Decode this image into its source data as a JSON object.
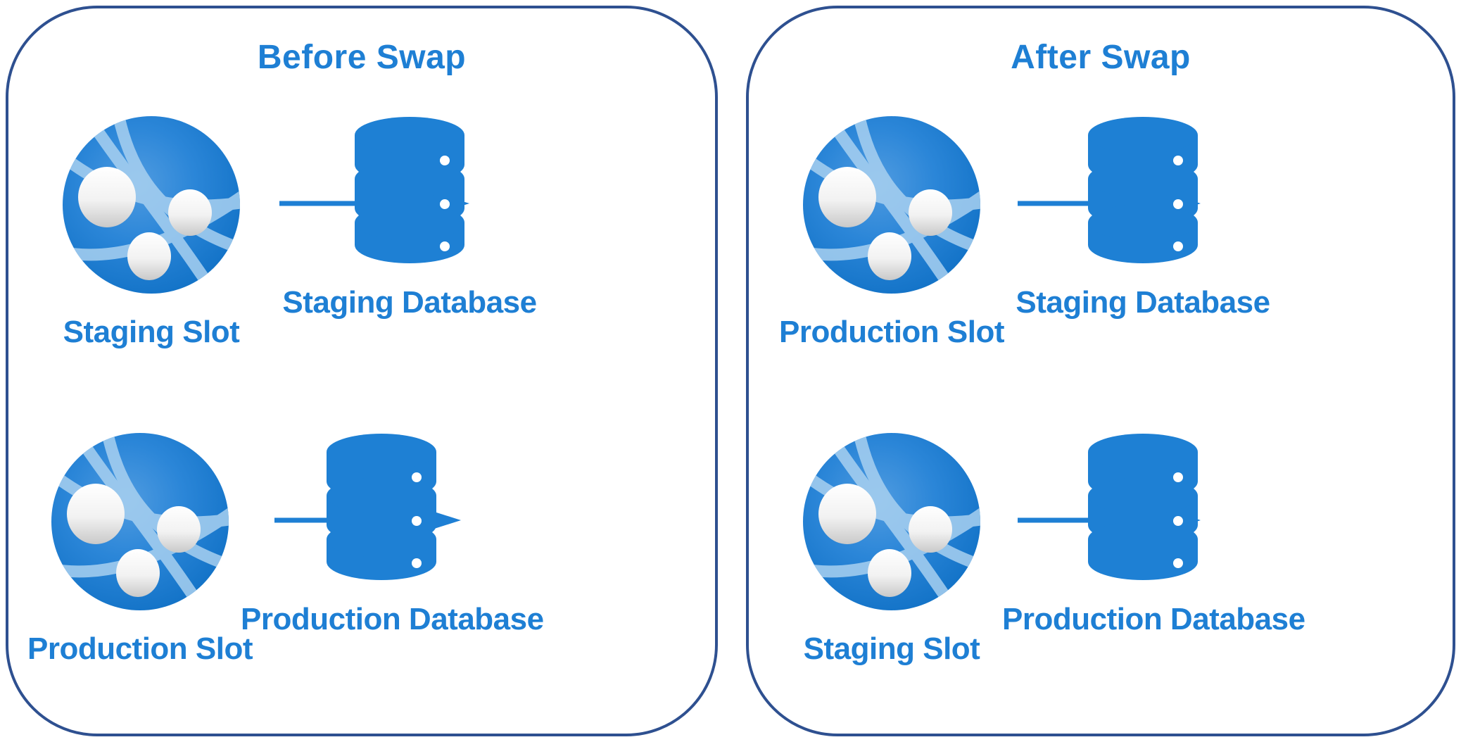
{
  "diagram": {
    "title_color": "#1E7FD4",
    "border_color": "#2E5090",
    "icon_blue": "#1E80D4",
    "icon_blue_light": "#9FC9EE",
    "arrow_color": "#1E7FD4",
    "panels": [
      {
        "id": "before",
        "title": "Before Swap",
        "rows": [
          {
            "slot": {
              "label": "Staging Slot",
              "icon": "network-sphere-icon"
            },
            "arrow": {
              "icon": "arrow-right-icon",
              "direction": "right"
            },
            "database": {
              "label": "Staging Database",
              "icon": "database-cylinder-icon"
            }
          },
          {
            "slot": {
              "label": "Production Slot",
              "icon": "network-sphere-icon"
            },
            "arrow": {
              "icon": "arrow-right-icon",
              "direction": "right"
            },
            "database": {
              "label": "Production Database",
              "icon": "database-cylinder-icon"
            }
          }
        ]
      },
      {
        "id": "after",
        "title": "After Swap",
        "rows": [
          {
            "slot": {
              "label": "Production Slot",
              "icon": "network-sphere-icon"
            },
            "arrow": {
              "icon": "arrow-right-icon",
              "direction": "right"
            },
            "database": {
              "label": "Staging Database",
              "icon": "database-cylinder-icon"
            }
          },
          {
            "slot": {
              "label": "Staging Slot",
              "icon": "network-sphere-icon"
            },
            "arrow": {
              "icon": "arrow-right-icon",
              "direction": "right"
            },
            "database": {
              "label": "Production Database",
              "icon": "database-cylinder-icon"
            }
          }
        ]
      }
    ]
  }
}
